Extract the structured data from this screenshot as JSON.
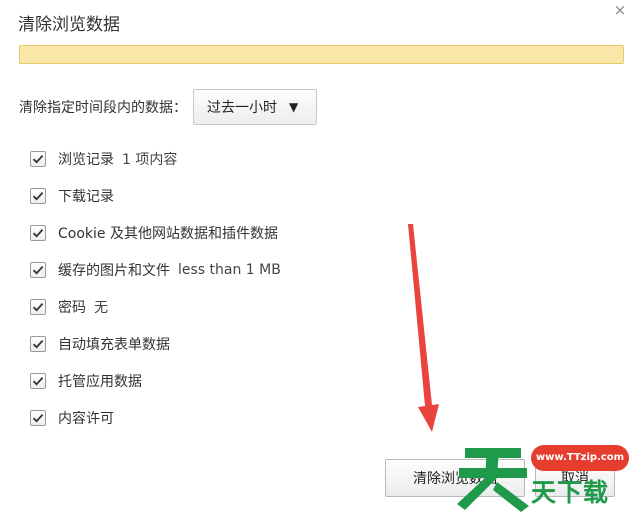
{
  "dialog": {
    "title": "清除浏览数据",
    "close_glyph": "×"
  },
  "time_range": {
    "label": "清除指定时间段内的数据：",
    "selected": "过去一小时",
    "arrow_glyph": "▼"
  },
  "options": [
    {
      "label": "浏览记录",
      "detail": "1 项内容",
      "checked": true
    },
    {
      "label": "下载记录",
      "detail": "",
      "checked": true
    },
    {
      "label": "Cookie 及其他网站数据和插件数据",
      "detail": "",
      "checked": true
    },
    {
      "label": "缓存的图片和文件",
      "detail": "less than 1 MB",
      "checked": true
    },
    {
      "label": "密码",
      "detail": "无",
      "checked": true
    },
    {
      "label": "自动填充表单数据",
      "detail": "",
      "checked": true
    },
    {
      "label": "托管应用数据",
      "detail": "",
      "checked": true
    },
    {
      "label": "内容许可",
      "detail": "",
      "checked": true
    }
  ],
  "buttons": {
    "clear_label": "清除浏览数据",
    "cancel_label": "取消"
  },
  "watermark": {
    "url": "www.TTzip.com",
    "text": "天下载"
  },
  "colors": {
    "notice_bar": "#f9e8a8",
    "arrow": "#e8302a",
    "watermark_green": "#1f9a4a",
    "watermark_red": "#e53e2f"
  }
}
